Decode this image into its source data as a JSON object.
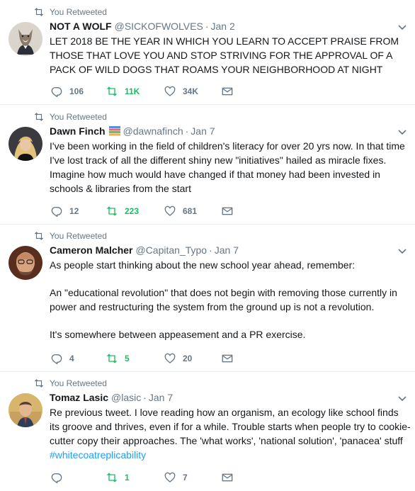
{
  "retweet_label": "You Retweeted",
  "colors": {
    "retweet_green": "#17bf63",
    "link_blue": "#1da1f2",
    "muted": "#657786",
    "divider": "#e6ecf0"
  },
  "icons": {
    "retweet": "retweet-icon",
    "reply": "reply-icon",
    "like": "heart-icon",
    "dm": "envelope-icon",
    "menu": "chevron-down-icon"
  },
  "tweets": [
    {
      "name": "NOT A WOLF",
      "handle": "@SICKOFWOLVES",
      "dot": "·",
      "time": "Jan 2",
      "text": [
        "LET 2018 BE THE YEAR IN WHICH YOU LEARN TO ACCEPT PRAISE FROM THOSE THAT LOVE YOU AND STOP STRIVING FOR THE APPROVAL OF A PACK OF WILD DOGS THAT ROAMS YOUR NEIGHBORHOOD AT NIGHT"
      ],
      "replies": "106",
      "retweets": "11K",
      "likes": "34K"
    },
    {
      "name": "Dawn Finch",
      "handle": "@dawnafinch",
      "dot": "·",
      "time": "Jan 7",
      "text": [
        "I've been working in the field of children's literacy for over 20 yrs now. In that time I've lost track of all the different shiny new \"initiatives\" hailed as miracle fixes. Imagine how much would have changed if that money had been invested in schools & libraries from the start"
      ],
      "replies": "12",
      "retweets": "223",
      "likes": "681"
    },
    {
      "name": "Cameron Malcher",
      "handle": "@Capitan_Typo",
      "dot": "·",
      "time": "Jan 7",
      "text": [
        "As people start thinking about the new school year ahead, remember:",
        "An \"educational revolution\" that does not begin with removing those currently in power and restructuring the system from the ground up is not a revolution.",
        "It's somewhere between appeasement and a PR exercise."
      ],
      "replies": "4",
      "retweets": "5",
      "likes": "20"
    },
    {
      "name": "Tomaz Lasic",
      "handle": "@lasic",
      "dot": "·",
      "time": "Jan 7",
      "text": [
        "Re previous tweet. I love reading how an organism, an ecology like school finds its groove and thrives, even if for a while. Trouble starts when people try to cookie-cutter copy their approaches. The 'what works', 'national solution', 'panacea' stuff "
      ],
      "hashtag": "#whitecoatreplicability",
      "replies": "",
      "retweets": "1",
      "likes": "7"
    }
  ]
}
